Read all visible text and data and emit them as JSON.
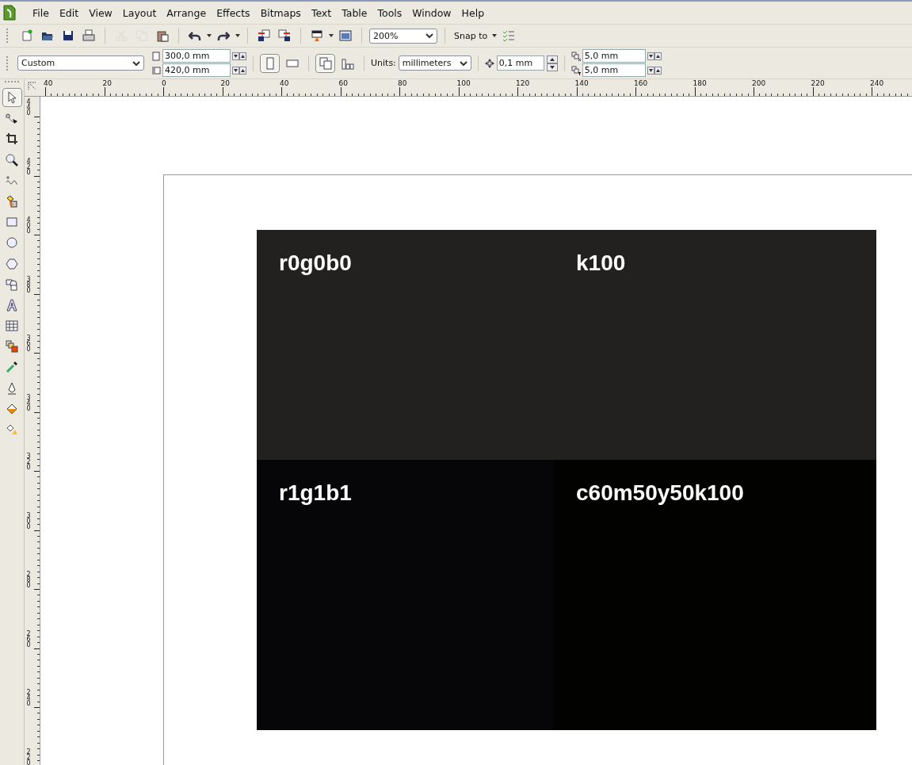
{
  "menu": [
    "File",
    "Edit",
    "View",
    "Layout",
    "Arrange",
    "Effects",
    "Bitmaps",
    "Text",
    "Table",
    "Tools",
    "Window",
    "Help"
  ],
  "toolbar": [
    [
      {
        "kind": "new",
        "disabled": false
      },
      {
        "kind": "open",
        "disabled": false
      },
      {
        "kind": "save",
        "disabled": false
      },
      {
        "kind": "print",
        "disabled": false
      }
    ],
    [
      {
        "kind": "cut",
        "disabled": true
      },
      {
        "kind": "copy",
        "disabled": true
      },
      {
        "kind": "paste",
        "disabled": false
      }
    ],
    [
      {
        "kind": "undo",
        "disabled": false
      },
      {
        "kind": "caret",
        "disabled": false
      },
      {
        "kind": "redo",
        "disabled": false
      },
      {
        "kind": "caret",
        "disabled": false
      }
    ],
    [
      {
        "kind": "import",
        "disabled": false
      },
      {
        "kind": "export",
        "disabled": false
      }
    ],
    [
      {
        "kind": "publish",
        "disabled": false
      },
      {
        "kind": "caret",
        "disabled": false
      },
      {
        "kind": "launcher",
        "disabled": false
      }
    ]
  ],
  "zoom_level": "200%",
  "snap_to": "Snap to",
  "property_bar": {
    "page_size": "Custom",
    "width": "300,0 mm",
    "height": "420,0 mm",
    "orientation": [
      {
        "kind": "portrait",
        "selected": true
      },
      {
        "kind": "landscape",
        "selected": false
      }
    ],
    "page_layout": [
      {
        "kind": "all-pages",
        "selected": true
      },
      {
        "kind": "current-page",
        "selected": false
      }
    ],
    "units_label": "Units:",
    "units": "millimeters",
    "nudge": "0,1 mm",
    "duplicate_x": "5,0 mm",
    "duplicate_y": "5,0 mm"
  },
  "horizontal_ruler": [
    "40",
    "20",
    "0",
    "20",
    "40",
    "60",
    "80",
    "100",
    "120",
    "140",
    "160",
    "180",
    "200",
    "220",
    "240"
  ],
  "vertical_ruler": [
    "440",
    "420",
    "400",
    "380",
    "360",
    "340",
    "320",
    "300",
    "280",
    "260",
    "240",
    "220"
  ],
  "tools": [
    {
      "kind": "pick",
      "selected": true
    },
    {
      "kind": "shape",
      "selected": false
    },
    {
      "kind": "crop",
      "selected": false
    },
    {
      "kind": "zoom",
      "selected": false
    },
    {
      "kind": "freehand",
      "selected": false
    },
    {
      "kind": "smart-fill",
      "selected": false
    },
    {
      "kind": "rectangle",
      "selected": false
    },
    {
      "kind": "ellipse",
      "selected": false
    },
    {
      "kind": "polygon",
      "selected": false
    },
    {
      "kind": "shapes",
      "selected": false
    },
    {
      "kind": "text",
      "selected": false
    },
    {
      "kind": "table",
      "selected": false
    },
    {
      "kind": "blend",
      "selected": false
    },
    {
      "kind": "eyedropper",
      "selected": false
    },
    {
      "kind": "outline",
      "selected": false
    },
    {
      "kind": "fill",
      "selected": false
    },
    {
      "kind": "interactive-fill",
      "selected": false
    }
  ],
  "swatches": [
    {
      "label": "r0g0b0",
      "color": "#222120"
    },
    {
      "label": "k100",
      "color": "#222120"
    },
    {
      "label": "r1g1b1",
      "color": "#060608"
    },
    {
      "label": "c60m50y50k100",
      "color": "#020201"
    }
  ]
}
